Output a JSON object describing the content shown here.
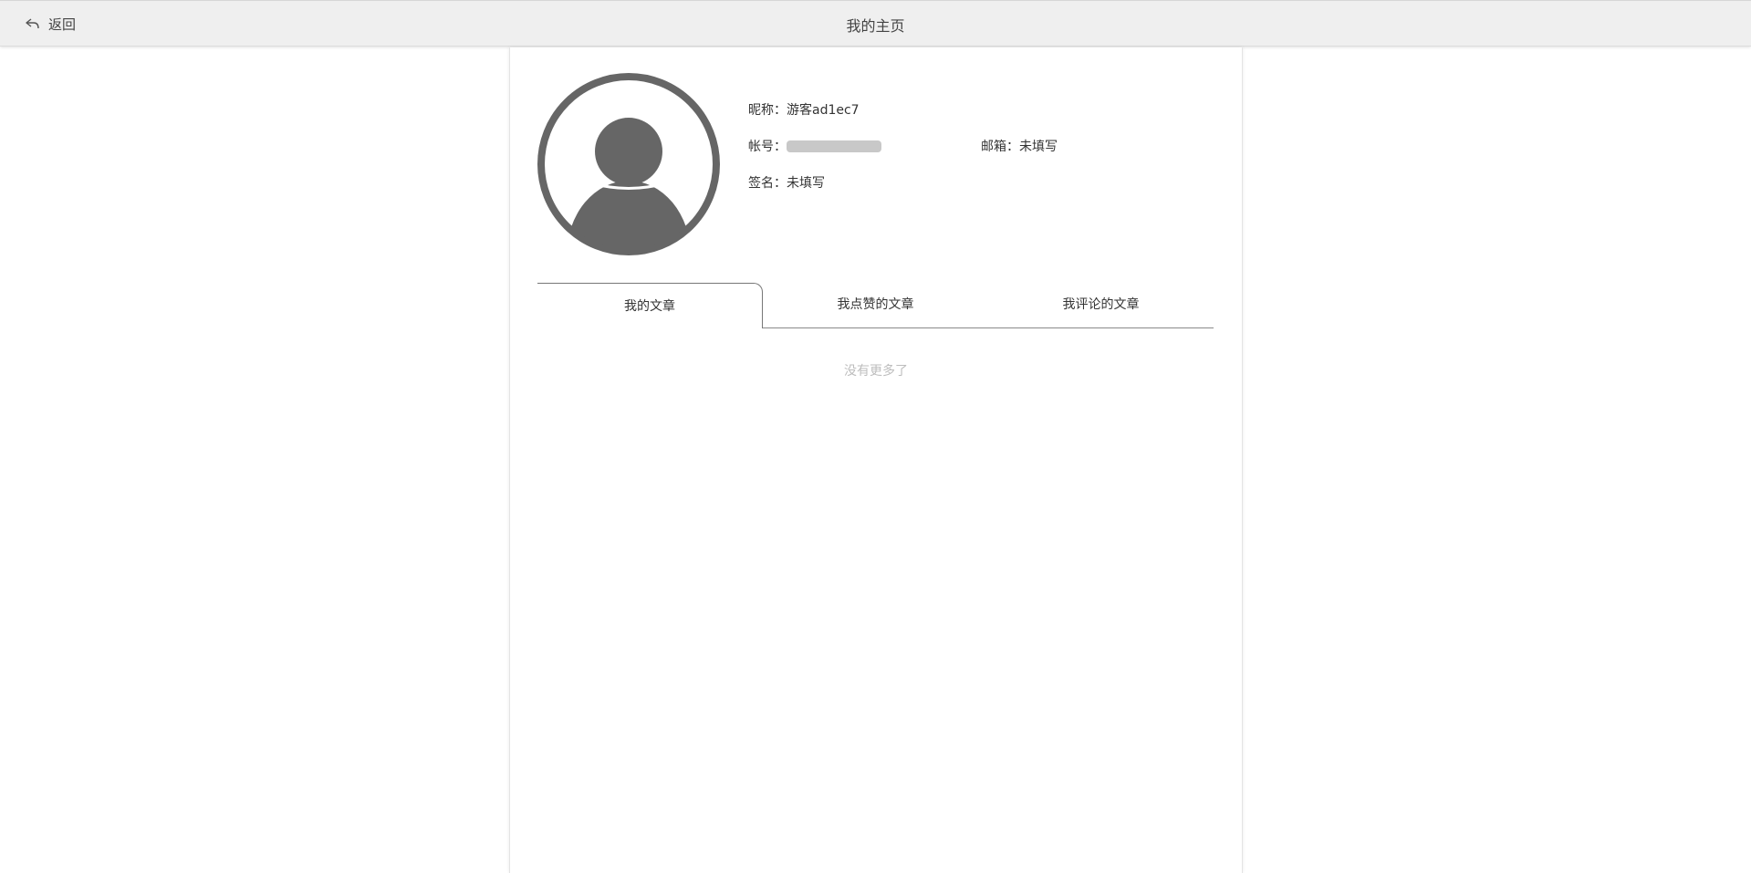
{
  "header": {
    "back_label": "返回",
    "title": "我的主页",
    "back_icon": "back-arrow-icon"
  },
  "profile": {
    "avatar_icon": "user-avatar-icon",
    "nickname": "昵称：游客ad1ec7",
    "account_label": "帐号：",
    "email": "邮箱：未填写",
    "signature": "签名：未填写"
  },
  "tabs": [
    {
      "label": "我的文章",
      "active": true
    },
    {
      "label": "我点赞的文章",
      "active": false
    },
    {
      "label": "我评论的文章",
      "active": false
    }
  ],
  "list": {
    "empty_text": "没有更多了"
  },
  "colors": {
    "topbar_bg": "#efefef",
    "avatar_gray": "#666666",
    "muted_text": "#bdbdbd"
  }
}
